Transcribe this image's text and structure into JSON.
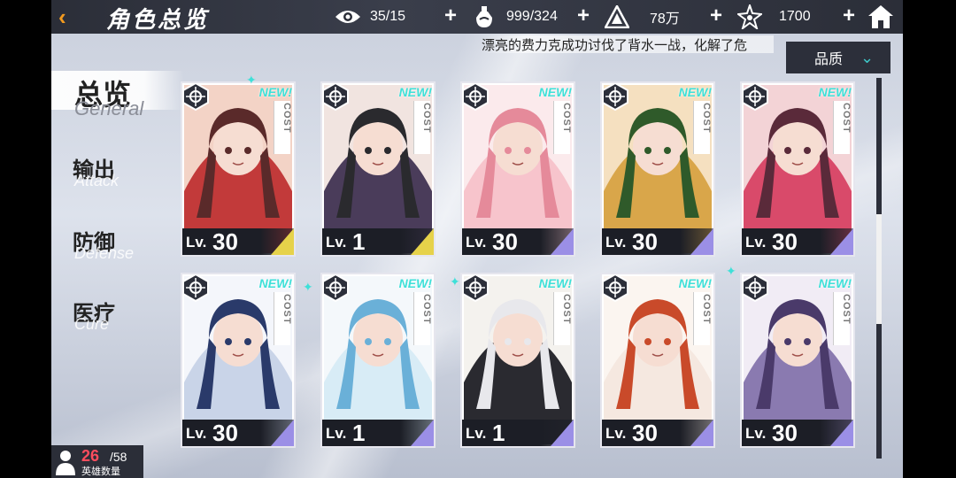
{
  "header": {
    "title": "角色总览",
    "resources": [
      {
        "icon": "eye-icon",
        "value": "35/15"
      },
      {
        "icon": "potion-icon",
        "value": "999/324"
      },
      {
        "icon": "triangle-gem-icon",
        "value": "78万"
      },
      {
        "icon": "star-crystal-icon",
        "value": "1700"
      }
    ]
  },
  "ticker": "漂亮的费力克成功讨伐了背水一战，化解了危",
  "filter": {
    "label": "品质"
  },
  "nav": {
    "general": {
      "zh": "总览",
      "en": "General"
    },
    "attack": {
      "zh": "输出",
      "en": "Attack"
    },
    "defense": {
      "zh": "防御",
      "en": "Defense"
    },
    "cure": {
      "zh": "医疗",
      "en": "Cure"
    }
  },
  "heroes": {
    "current": "26",
    "max": "/58",
    "label": "英雄数量"
  },
  "cards": [
    {
      "level_prefix": "Lv.",
      "level": "30",
      "new": "NEW!",
      "cost": "COST",
      "class_icon": "shield-wings-icon",
      "rarity_color": "#e6d24a"
    },
    {
      "level_prefix": "Lv.",
      "level": "1",
      "new": "NEW!",
      "cost": "COST",
      "class_icon": "demon-horns-icon",
      "rarity_color": "#e6d24a"
    },
    {
      "level_prefix": "Lv.",
      "level": "30",
      "new": "NEW!",
      "cost": "COST",
      "class_icon": "heart-icon",
      "rarity_color": "#9b8fe6"
    },
    {
      "level_prefix": "Lv.",
      "level": "30",
      "new": "NEW!",
      "cost": "COST",
      "class_icon": "bow-icon",
      "rarity_color": "#9b8fe6"
    },
    {
      "level_prefix": "Lv.",
      "level": "30",
      "new": "NEW!",
      "cost": "COST",
      "class_icon": "demon-horns-icon",
      "rarity_color": "#9b8fe6"
    },
    {
      "level_prefix": "Lv.",
      "level": "30",
      "new": "NEW!",
      "cost": "COST",
      "class_icon": "sword-icon",
      "rarity_color": "#9b8fe6"
    },
    {
      "level_prefix": "Lv.",
      "level": "1",
      "new": "NEW!",
      "cost": "COST",
      "class_icon": "snowflake-icon",
      "rarity_color": "#9b8fe6"
    },
    {
      "level_prefix": "Lv.",
      "level": "1",
      "new": "NEW!",
      "cost": "COST",
      "class_icon": "gun-icon",
      "rarity_color": "#9b8fe6"
    },
    {
      "level_prefix": "Lv.",
      "level": "30",
      "new": "NEW!",
      "cost": "COST",
      "class_icon": "shield-wings-icon",
      "rarity_color": "#9b8fe6"
    },
    {
      "level_prefix": "Lv.",
      "level": "30",
      "new": "NEW!",
      "cost": "COST",
      "class_icon": "shuriken-icon",
      "rarity_color": "#9b8fe6"
    }
  ]
}
